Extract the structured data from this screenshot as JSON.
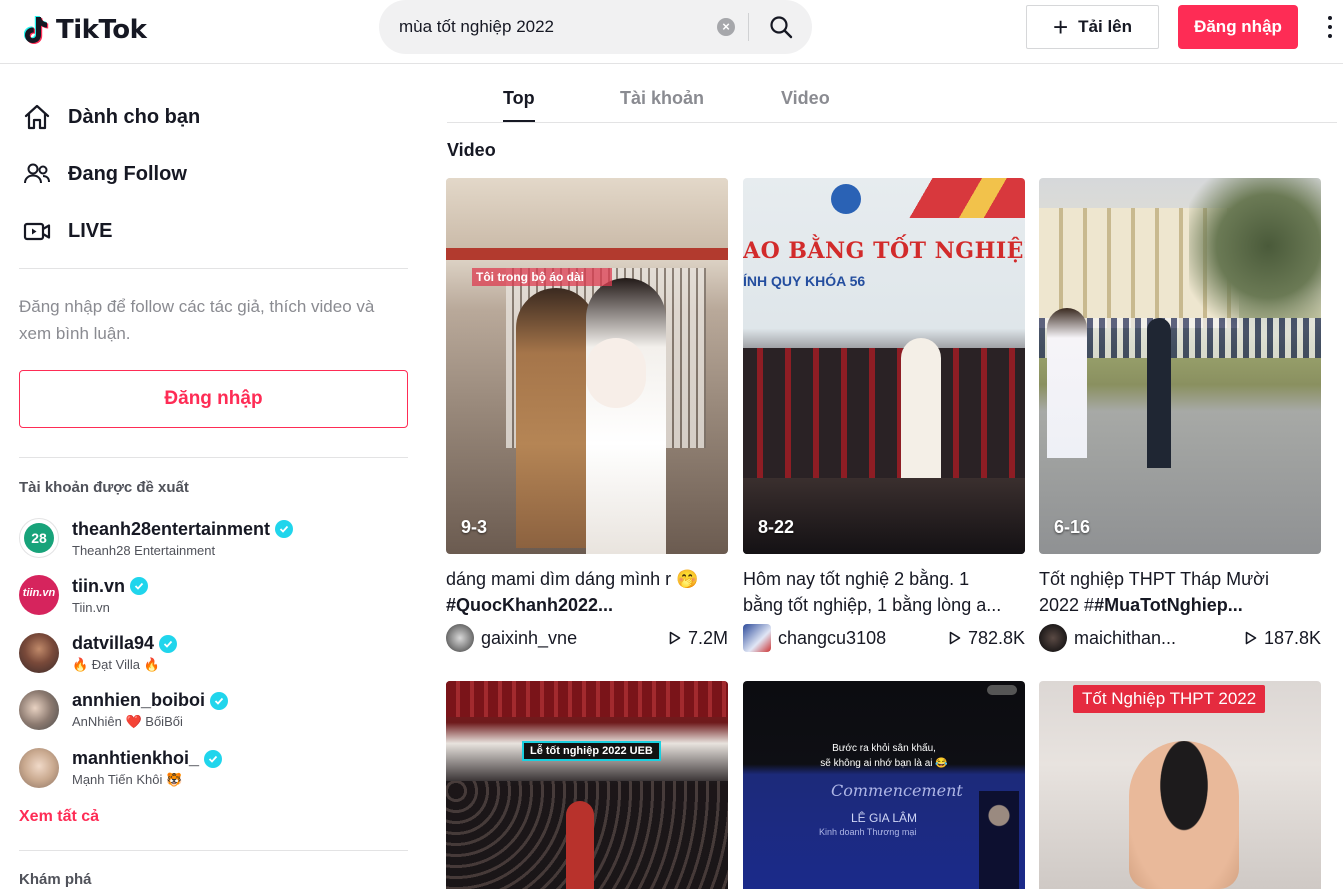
{
  "header": {
    "logo_text": "TikTok",
    "search_value": "mùa tốt nghiệp 2022",
    "upload_label": "Tải lên",
    "login_label": "Đăng nhập"
  },
  "sidebar": {
    "nav": [
      {
        "label": "Dành cho bạn",
        "icon": "home-icon"
      },
      {
        "label": "Đang Follow",
        "icon": "people-icon"
      },
      {
        "label": "LIVE",
        "icon": "live-icon"
      }
    ],
    "login_hint": "Đăng nhập để follow các tác giả, thích video và xem bình luận.",
    "login_button": "Đăng nhập",
    "suggested_title": "Tài khoản được đề xuất",
    "accounts": [
      {
        "name": "theanh28entertainment",
        "sub": "Theanh28 Entertainment",
        "avatar_text": "28"
      },
      {
        "name": "tiin.vn",
        "sub": "Tiin.vn",
        "avatar_text": "tiin.vn"
      },
      {
        "name": "datvilla94",
        "sub": "🔥 Đạt Villa 🔥"
      },
      {
        "name": "annhien_boiboi",
        "sub": "AnNhiên ❤️ BốiBối"
      },
      {
        "name": "manhtienkhoi_",
        "sub": "Mạnh Tiến Khôi 🐯"
      }
    ],
    "see_all": "Xem tất cả",
    "discover_title": "Khám phá"
  },
  "tabs": [
    "Top",
    "Tài khoản",
    "Video"
  ],
  "section_title": "Video",
  "videos": [
    {
      "date": "9-3",
      "desc_line1": "dáng mami dìm dáng mình r 🤭",
      "desc_line2": "#QuocKhanh2022...",
      "author": "gaixinh_vne",
      "views": "7.2M",
      "overlay_top": "Tôi trong bộ áo dài"
    },
    {
      "date": "8-22",
      "desc_line1": "Hôm nay tốt nghiệ 2 bằng. 1",
      "desc_line2": "bằng tốt nghiệp, 1 bằng lòng a...",
      "author": "changcu3108",
      "views": "782.8K",
      "overlay_title": "AO BẰNG TỐT NGHIỆP",
      "overlay_sub": "ÍNH QUY KHÓA 56"
    },
    {
      "date": "6-16",
      "desc_line1": "Tốt nghiệp THPT Tháp Mười",
      "desc_line2_prefix": "2022 #",
      "desc_line2_tag": "#MuaTotNghiep...",
      "author": "maichithan...",
      "views": "187.8K"
    },
    {
      "overlay": "Lễ tốt nghiệp 2022 UEB"
    },
    {
      "overlay1": "Bước ra khỏi sân khấu,",
      "overlay2": "sẽ không ai nhớ bạn là ai 😂",
      "overlay3": "Commencement",
      "overlay4": "LÊ GIA LÂM",
      "overlay5": "Kinh doanh Thương mại"
    },
    {
      "overlay": "Tốt Nghiệp THPT 2022"
    }
  ],
  "colors": {
    "brand": "#fe2c55",
    "verified": "#20d5ec"
  }
}
